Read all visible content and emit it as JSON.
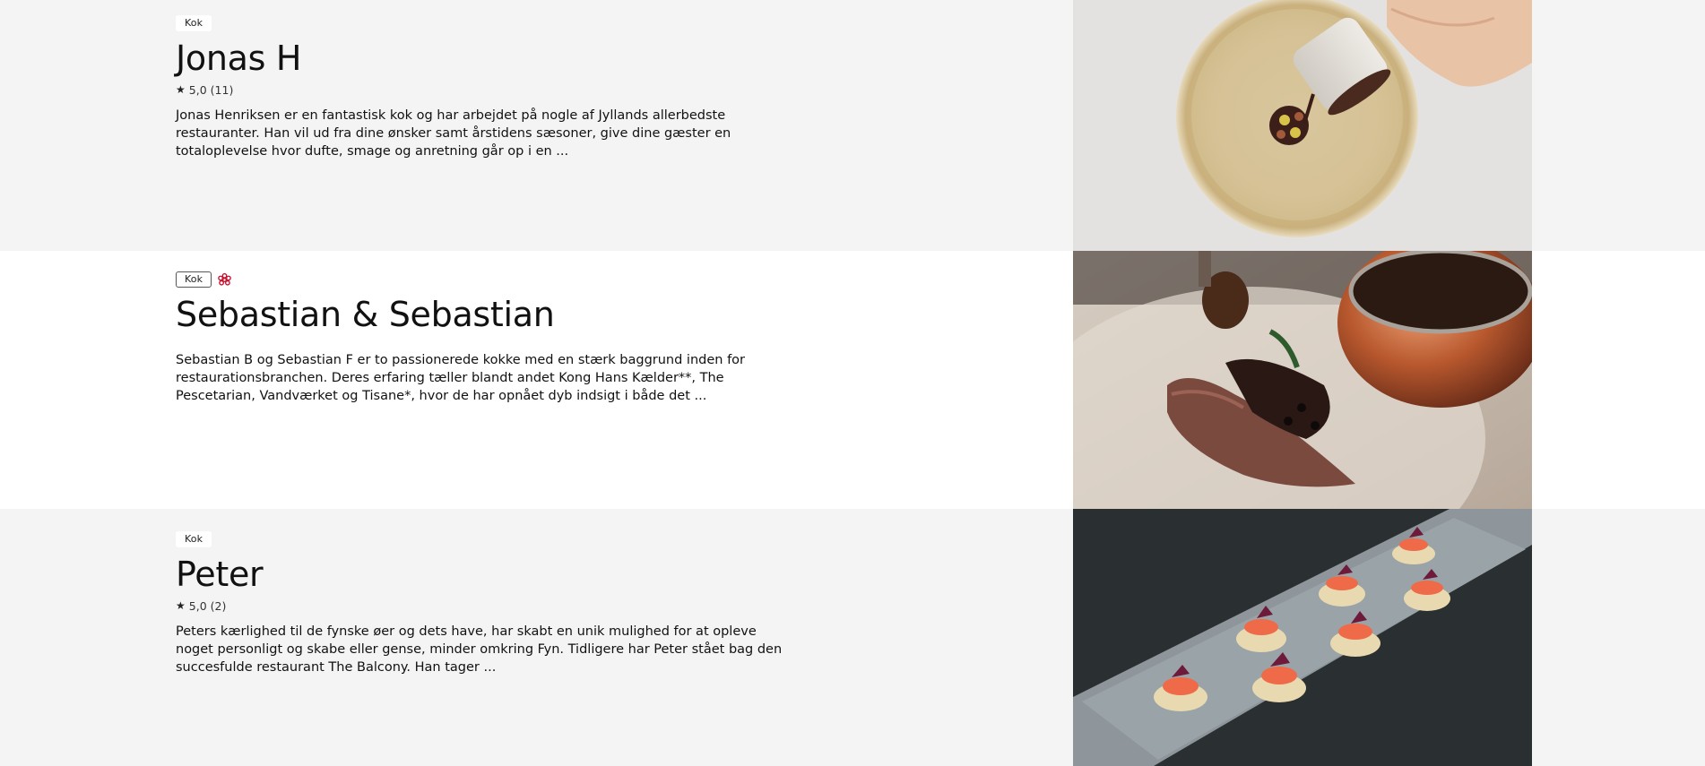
{
  "chefs": [
    {
      "badge": "Kok",
      "name": "Jonas H",
      "rating": "5,0",
      "reviews": "(11)",
      "description": "Jonas Henriksen er en fantastisk kok og har arbejdet på nogle af Jyllands allerbedste restauranter. Han vil ud fra dine ønsker samt årstidens sæsoner, give dine gæster en totaloplevelse hvor dufte, smage og anretning går op i en ...",
      "photo_icon": "dish-with-sauce-pour-photo"
    },
    {
      "badge": "Kok",
      "badge_icon": "michelin-star-icon",
      "name": "Sebastian & Sebastian",
      "description": "Sebastian B og Sebastian F er to passionerede kokke med en stærk baggrund inden for restaurationsbranchen. Deres erfaring tæller blandt andet Kong Hans Kælder**, The Pescetarian, Vandværket og Tisane*, hvor de har opnået dyb indsigt i både det ...",
      "photo_icon": "duck-breast-with-copper-pot-photo"
    },
    {
      "badge": "Kok",
      "name": "Peter",
      "rating": "5,0",
      "reviews": "(2)",
      "description": "Peters kærlighed til de fynske øer og dets have, har skabt en unik mulighed for at opleve noget personligt og skabe eller gense, minder omkring Fyn. Tidligere har Peter stået bag den succesfulde restaurant The Balcony. Han tager ...",
      "photo_icon": "salmon-canapes-platter-photo"
    }
  ],
  "colors": {
    "card_gray": "#f4f4f4",
    "card_white": "#ffffff",
    "michelin_red": "#c8102e",
    "text": "#111111"
  }
}
